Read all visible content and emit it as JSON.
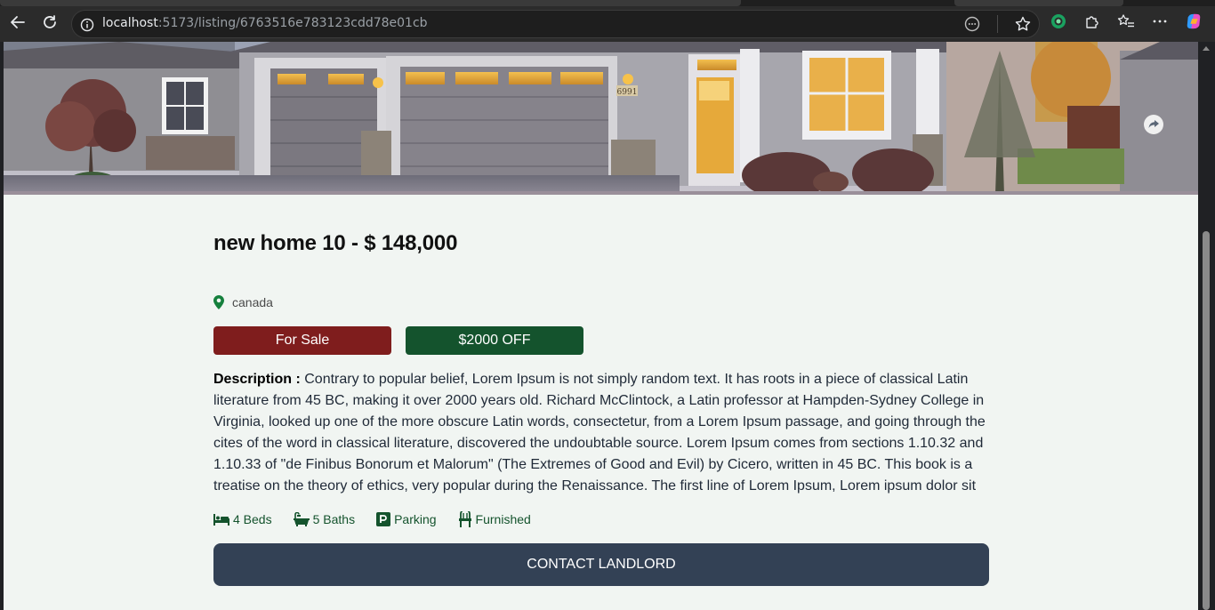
{
  "browser": {
    "url_host": "localhost",
    "url_path": ":5173/listing/6763516e783123cdd78e01cb"
  },
  "hero": {
    "house_number": "6991"
  },
  "listing": {
    "title": "new home 10 - $ 148,000",
    "location": "canada",
    "type_badge": "For Sale",
    "discount_badge": "$2000 OFF",
    "description_label": "Description :",
    "description": " Contrary to popular belief, Lorem Ipsum is not simply random text. It has roots in a piece of classical Latin literature from 45 BC, making it over 2000 years old. Richard McClintock, a Latin professor at Hampden-Sydney College in Virginia, looked up one of the more obscure Latin words, consectetur, from a Lorem Ipsum passage, and going through the cites of the word in classical literature, discovered the undoubtable source. Lorem Ipsum comes from sections 1.10.32 and 1.10.33 of \"de Finibus Bonorum et Malorum\" (The Extremes of Good and Evil) by Cicero, written in 45 BC. This book is a treatise on the theory of ethics, very popular during the Renaissance. The first line of Lorem Ipsum, Lorem ipsum dolor sit",
    "features": {
      "beds": "4 Beds",
      "baths": "5 Baths",
      "parking": "Parking",
      "furnished": "Furnished"
    },
    "contact_label": "CONTACT LANDLORD"
  },
  "colors": {
    "sale": "#7f1d1d",
    "offer": "#14532d",
    "contact": "#334155",
    "page_bg": "#f1f5f2"
  }
}
